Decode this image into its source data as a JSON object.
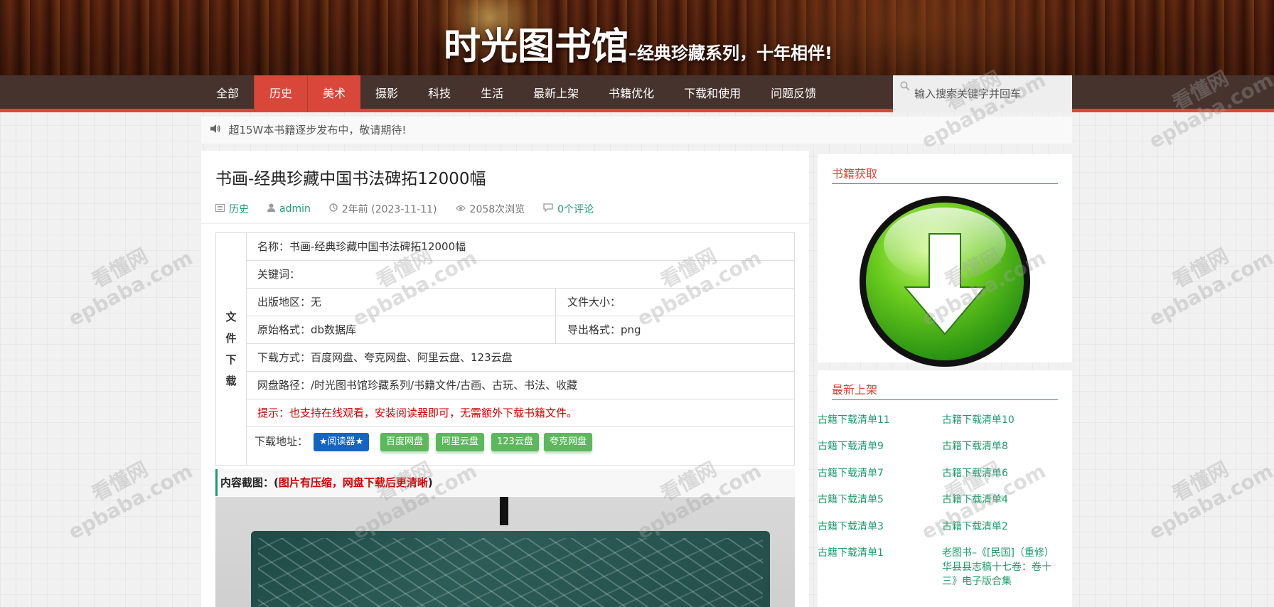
{
  "site": {
    "title": "时光图书馆",
    "slogan": "–经典珍藏系列，十年相伴!"
  },
  "nav": {
    "items": [
      {
        "label": "全部",
        "active": false
      },
      {
        "label": "历史",
        "active": true
      },
      {
        "label": "美术",
        "active": true
      },
      {
        "label": "摄影",
        "active": false
      },
      {
        "label": "科技",
        "active": false
      },
      {
        "label": "生活",
        "active": false
      },
      {
        "label": "最新上架",
        "active": false
      },
      {
        "label": "书籍优化",
        "active": false
      },
      {
        "label": "下载和使用",
        "active": false
      },
      {
        "label": "问题反馈",
        "active": false
      }
    ],
    "search_placeholder": "输入搜索关键字并回车"
  },
  "notice": {
    "text": "超15W本书籍逐步发布中，敬请期待!"
  },
  "article": {
    "title": "书画-经典珍藏中国书法碑拓12000幅",
    "meta": {
      "category": "历史",
      "author": "admin",
      "time": "2年前 (2023-11-11)",
      "views": "2058次浏览",
      "comments": "0个评论"
    },
    "download_table": {
      "side_label": [
        "文",
        "件",
        "下",
        "载"
      ],
      "name": "名称：书画-经典珍藏中国书法碑拓12000幅",
      "keywords": "关键词：",
      "region": "出版地区：无",
      "file_size": "文件大小：",
      "orig_format": "原始格式：db数据库",
      "export_format": "导出格式：png",
      "method": "下载方式：百度网盘、夸克网盘、阿里云盘、123云盘",
      "path": "网盘路径：/时光图书馆珍藏系列/书籍文件/古画、古玩、书法、收藏",
      "tip": "提示：也支持在线观看，安装阅读器即可，无需额外下载书籍文件。",
      "dl_label": "下载地址：",
      "buttons": [
        "★阅读器★",
        "百度网盘",
        "阿里云盘",
        "123云盘",
        "夸克网盘"
      ]
    },
    "content_head": {
      "prefix": "内容截图：(",
      "highlight": "图片有压缩，网盘下载后更清晰",
      "suffix": ")"
    }
  },
  "sidebar": {
    "get_books_title": "书籍获取",
    "latest_title": "最新上架",
    "latest_items": [
      "古籍下载清单11",
      "古籍下载清单10",
      "古籍下载清单9",
      "古籍下载清单8",
      "古籍下载清单7",
      "古籍下载清单6",
      "古籍下载清单5",
      "古籍下载清单4",
      "古籍下载清单3",
      "古籍下载清单2",
      "古籍下载清单1",
      "老图书–《[民国]（重修）华县县志稿十七卷：卷十三》电子版合集"
    ]
  },
  "watermark": {
    "line1": "看懂网",
    "line2": "epbaba.com"
  },
  "colors": {
    "accent_red": "#d9473a",
    "link_green": "#1e9c6e",
    "reader_blue": "#1565c0",
    "button_green": "#5cb85c"
  },
  "icons": [
    "search-icon",
    "speaker-icon",
    "category-icon",
    "user-icon",
    "clock-icon",
    "eye-icon",
    "comment-icon",
    "download-icon"
  ]
}
